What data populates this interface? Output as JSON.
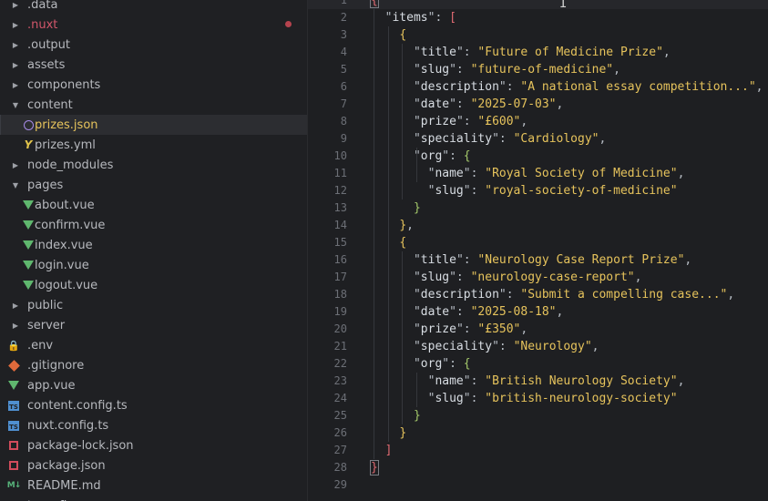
{
  "explorer": {
    "items": [
      {
        "name": ".data",
        "type": "folder",
        "expanded": false,
        "depth": 0
      },
      {
        "name": ".nuxt",
        "type": "folder",
        "expanded": false,
        "depth": 0,
        "modified": true
      },
      {
        "name": ".output",
        "type": "folder",
        "expanded": false,
        "depth": 0
      },
      {
        "name": "assets",
        "type": "folder",
        "expanded": false,
        "depth": 0
      },
      {
        "name": "components",
        "type": "folder",
        "expanded": false,
        "depth": 0
      },
      {
        "name": "content",
        "type": "folder",
        "expanded": true,
        "depth": 0
      },
      {
        "name": "prizes.json",
        "type": "json",
        "depth": 1,
        "selected": true
      },
      {
        "name": "prizes.yml",
        "type": "yml",
        "depth": 1
      },
      {
        "name": "node_modules",
        "type": "folder",
        "expanded": false,
        "depth": 0
      },
      {
        "name": "pages",
        "type": "folder",
        "expanded": true,
        "depth": 0
      },
      {
        "name": "about.vue",
        "type": "vue",
        "depth": 1
      },
      {
        "name": "confirm.vue",
        "type": "vue",
        "depth": 1
      },
      {
        "name": "index.vue",
        "type": "vue",
        "depth": 1
      },
      {
        "name": "login.vue",
        "type": "vue",
        "depth": 1
      },
      {
        "name": "logout.vue",
        "type": "vue",
        "depth": 1
      },
      {
        "name": "public",
        "type": "folder",
        "expanded": false,
        "depth": 0
      },
      {
        "name": "server",
        "type": "folder",
        "expanded": false,
        "depth": 0
      },
      {
        "name": ".env",
        "type": "lock",
        "depth": 0
      },
      {
        "name": ".gitignore",
        "type": "git",
        "depth": 0
      },
      {
        "name": "app.vue",
        "type": "vue",
        "depth": 0
      },
      {
        "name": "content.config.ts",
        "type": "ts",
        "depth": 0
      },
      {
        "name": "nuxt.config.ts",
        "type": "ts",
        "depth": 0
      },
      {
        "name": "package-lock.json",
        "type": "npm",
        "depth": 0
      },
      {
        "name": "package.json",
        "type": "npm",
        "depth": 0
      },
      {
        "name": "README.md",
        "type": "md",
        "depth": 0
      },
      {
        "name": "tsconfig...",
        "type": "cfg",
        "depth": 0
      }
    ]
  },
  "editor": {
    "line_numbers": [
      "1",
      "2",
      "3",
      "4",
      "5",
      "6",
      "7",
      "8",
      "9",
      "10",
      "11",
      "12",
      "13",
      "14",
      "15",
      "16",
      "17",
      "18",
      "19",
      "20",
      "21",
      "22",
      "23",
      "24",
      "25",
      "26",
      "27",
      "28",
      "29"
    ],
    "keys": {
      "items": "items",
      "title": "title",
      "slug": "slug",
      "description": "description",
      "date": "date",
      "prize": "prize",
      "speciality": "speciality",
      "org": "org",
      "name": "name"
    },
    "entries": [
      {
        "title": "Future of Medicine Prize",
        "slug": "future-of-medicine",
        "description": "A national essay competition...",
        "date": "2025-07-03",
        "prize": "£600",
        "speciality": "Cardiology",
        "org": {
          "name": "Royal Society of Medicine",
          "slug": "royal-society-of-medicine"
        }
      },
      {
        "title": "Neurology Case Report Prize",
        "slug": "neurology-case-report",
        "description": "Submit a compelling case...",
        "date": "2025-08-18",
        "prize": "£350",
        "speciality": "Neurology",
        "org": {
          "name": "British Neurology Society",
          "slug": "british-neurology-society"
        }
      }
    ]
  }
}
